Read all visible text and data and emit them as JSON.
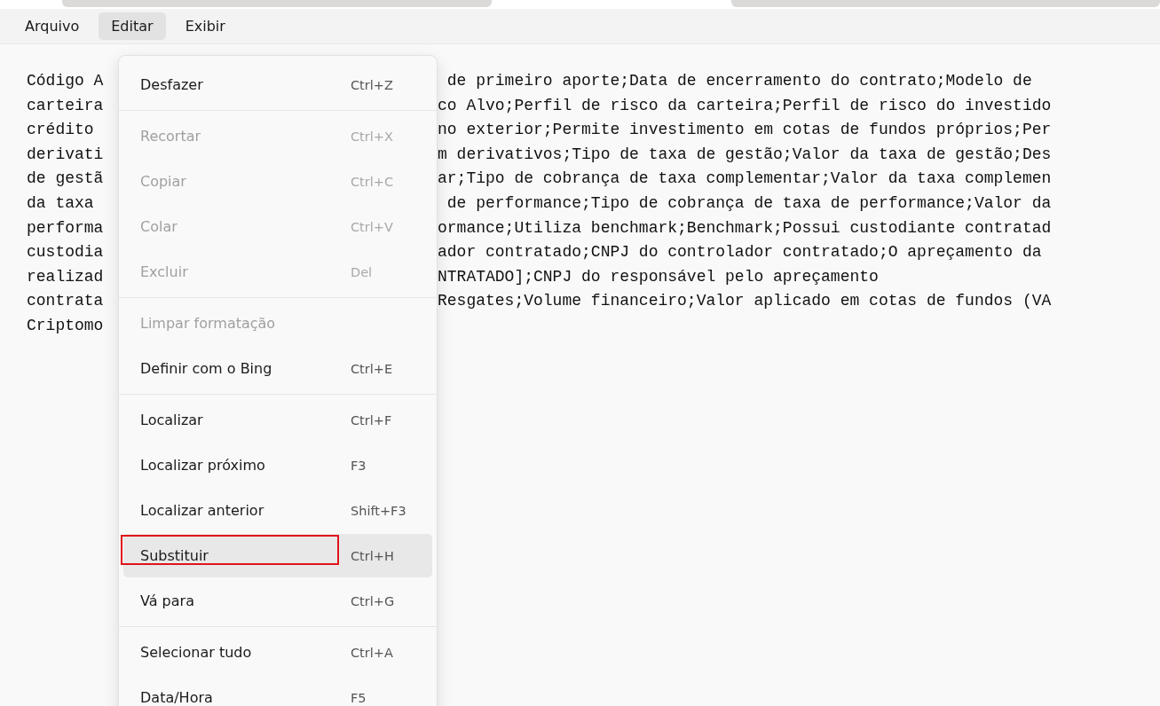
{
  "menu_bar": [
    {
      "label": "Arquivo",
      "selected": false
    },
    {
      "label": "Editar",
      "selected": true
    },
    {
      "label": "Exibir",
      "selected": false
    }
  ],
  "editor": {
    "lines": [
      {
        "left": "Código A",
        "right": " de primeiro aporte;Data de encerramento do contrato;Modelo de"
      },
      {
        "left": "carteira",
        "right": "co Alvo;Perfil de risco da carteira;Perfil de risco do investido"
      },
      {
        "left": "crédito",
        "right": "no exterior;Permite investimento em cotas de fundos próprios;Per"
      },
      {
        "left": "derivati",
        "right": "m derivativos;Tipo de taxa de gestão;Valor da taxa de gestão;Des"
      },
      {
        "left": "de gestã",
        "right": "ar;Tipo de cobrança de taxa complementar;Valor da taxa complemen"
      },
      {
        "left": "da taxa",
        "right": " de performance;Tipo de cobrança de taxa de performance;Valor da"
      },
      {
        "left": "performa",
        "right": "ormance;Utiliza benchmark;Benchmark;Possui custodiante contratad"
      },
      {
        "left": "custodia",
        "right": "ador contratado;CNPJ do controlador contratado;O apreçamento da"
      },
      {
        "left": "realizad",
        "right": "NTRATADO];CNPJ do responsável pelo apreçamento"
      },
      {
        "left": "contrata",
        "right": "Resgates;Volume financeiro;Valor aplicado em cotas de fundos (VA"
      },
      {
        "left": "Criptomo"
      }
    ]
  },
  "edit_menu": {
    "groups": [
      [
        {
          "label": "Desfazer",
          "shortcut": "Ctrl+Z",
          "disabled": false,
          "hovered": false,
          "annotated": false
        }
      ],
      [
        {
          "label": "Recortar",
          "shortcut": "Ctrl+X",
          "disabled": true,
          "hovered": false,
          "annotated": false
        },
        {
          "label": "Copiar",
          "shortcut": "Ctrl+C",
          "disabled": true,
          "hovered": false,
          "annotated": false
        },
        {
          "label": "Colar",
          "shortcut": "Ctrl+V",
          "disabled": true,
          "hovered": false,
          "annotated": false
        },
        {
          "label": "Excluir",
          "shortcut": "Del",
          "disabled": true,
          "hovered": false,
          "annotated": false
        }
      ],
      [
        {
          "label": "Limpar formatação",
          "disabled": true,
          "hovered": false,
          "annotated": false
        },
        {
          "label": "Definir com o Bing",
          "shortcut": "Ctrl+E",
          "disabled": false,
          "hovered": false,
          "annotated": false
        }
      ],
      [
        {
          "label": "Localizar",
          "shortcut": "Ctrl+F",
          "disabled": false,
          "hovered": false,
          "annotated": false
        },
        {
          "label": "Localizar próximo",
          "shortcut": "F3",
          "disabled": false,
          "hovered": false,
          "annotated": false
        },
        {
          "label": "Localizar anterior",
          "shortcut": "Shift+F3",
          "disabled": false,
          "hovered": false,
          "annotated": false
        },
        {
          "label": "Substituir",
          "shortcut": "Ctrl+H",
          "disabled": false,
          "hovered": true,
          "annotated": true
        },
        {
          "label": "Vá para",
          "shortcut": "Ctrl+G",
          "disabled": false,
          "hovered": false,
          "annotated": false
        }
      ],
      [
        {
          "label": "Selecionar tudo",
          "shortcut": "Ctrl+A",
          "disabled": false,
          "hovered": false,
          "annotated": false
        },
        {
          "label": "Data/Hora",
          "shortcut": "F5",
          "disabled": false,
          "hovered": false,
          "annotated": false
        }
      ]
    ]
  }
}
